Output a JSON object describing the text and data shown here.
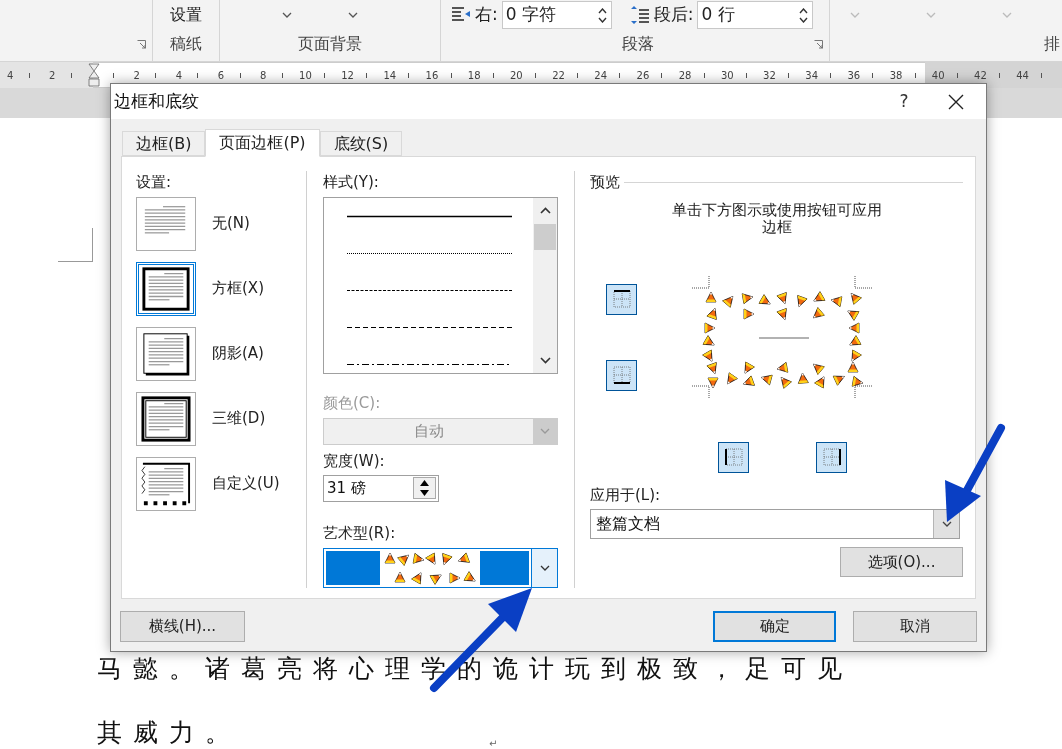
{
  "ribbon": {
    "setup_button": "设置",
    "group_labels": [
      {
        "label": "稿纸"
      },
      {
        "label": "页面背景"
      },
      {
        "label": "段落"
      },
      {
        "label": "排"
      }
    ],
    "indent_right": {
      "label": "右:",
      "value": "0 字符"
    },
    "spacing_after": {
      "label": "段后:",
      "value": "0 行"
    }
  },
  "ruler": {
    "left_labels": [
      "4",
      "2"
    ],
    "right_labels": [
      "2",
      "4",
      "6",
      "8",
      "10",
      "12",
      "14",
      "16",
      "18",
      "20",
      "22",
      "24",
      "26",
      "28",
      "30",
      "32",
      "34",
      "36",
      "38",
      "40",
      "42",
      "44"
    ]
  },
  "document": {
    "lines": [
      "马懿。诸葛亮将心理学的诡计玩到极致，足可见",
      "其威力。"
    ],
    "paragraph_mark": "↵"
  },
  "dialog": {
    "title": "边框和底纹",
    "help_button": "?",
    "tabs": [
      {
        "label": "边框(B)",
        "selected": false
      },
      {
        "label": "页面边框(P)",
        "selected": true
      },
      {
        "label": "底纹(S)",
        "selected": false
      }
    ],
    "settings": {
      "label": "设置:",
      "items": [
        {
          "kind": "none",
          "label": "无(N)",
          "selected": false
        },
        {
          "kind": "box",
          "label": "方框(X)",
          "selected": true
        },
        {
          "kind": "shadow",
          "label": "阴影(A)",
          "selected": false
        },
        {
          "kind": "threed",
          "label": "三维(D)",
          "selected": false
        },
        {
          "kind": "custom",
          "label": "自定义(U)",
          "selected": false
        }
      ]
    },
    "style": {
      "label": "样式(Y):",
      "lines": [
        {
          "kind": "solid"
        },
        {
          "kind": "dotted"
        },
        {
          "kind": "fine-dashed"
        },
        {
          "kind": "dashed"
        },
        {
          "kind": "dash-dot"
        }
      ]
    },
    "color": {
      "label": "颜色(C):",
      "value": "自动",
      "disabled": true
    },
    "width": {
      "label": "宽度(W):",
      "value": "31 磅"
    },
    "art": {
      "label": "艺术型(R):"
    },
    "preview": {
      "label": "预览",
      "hint": "单击下方图示或使用按钮可应用边框",
      "edge_buttons": [
        {
          "kind": "top",
          "on": true
        },
        {
          "kind": "bottom",
          "on": true
        },
        {
          "kind": "left",
          "on": true
        },
        {
          "kind": "right",
          "on": true
        }
      ]
    },
    "apply_to": {
      "label": "应用于(L):",
      "value": "整篇文档"
    },
    "options_button": "选项(O)...",
    "horizontal_line_button": "横线(H)...",
    "ok_button": "确定",
    "cancel_button": "取消"
  }
}
